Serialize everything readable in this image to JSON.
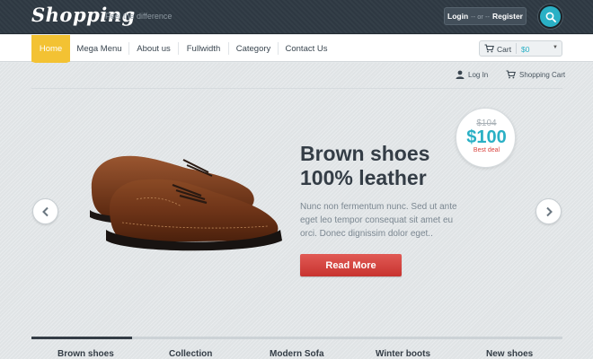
{
  "header": {
    "logo_text": "Shopping",
    "tagline": "Feel the difference",
    "login_label": "Login",
    "or_label": "-- or --",
    "register_label": "Register"
  },
  "nav": {
    "items": [
      {
        "label": "Home",
        "active": true
      },
      {
        "label": "Mega Menu"
      },
      {
        "label": "About us"
      },
      {
        "label": "Fullwidth"
      },
      {
        "label": "Category"
      },
      {
        "label": "Contact Us"
      }
    ],
    "cart_label": "Cart",
    "cart_amount": "$0"
  },
  "utility": {
    "login_link": "Log In",
    "cart_link": "Shopping Cart"
  },
  "slide": {
    "title_line1": "Brown shoes",
    "title_line2": "100% leather",
    "description": "Nunc non fermentum nunc. Sed ut ante eget leo tempor consequat sit amet eu orci. Donec dignissim dolor eget..",
    "button_label": "Read More",
    "price_old": "$104",
    "price_new": "$100",
    "price_tag": "Best deal",
    "progress": 0.19
  },
  "categories": [
    "Brown shoes",
    "Collection",
    "Modern Sofa",
    "Winter boots",
    "New shoes"
  ],
  "colors": {
    "accent": "#2ab0c5",
    "nav_active": "#f3c233",
    "button": "#d9433e",
    "topbar": "#2f3a44"
  },
  "icons": [
    "search-icon",
    "cart-icon",
    "user-icon",
    "chevron-left-icon",
    "chevron-right-icon"
  ]
}
